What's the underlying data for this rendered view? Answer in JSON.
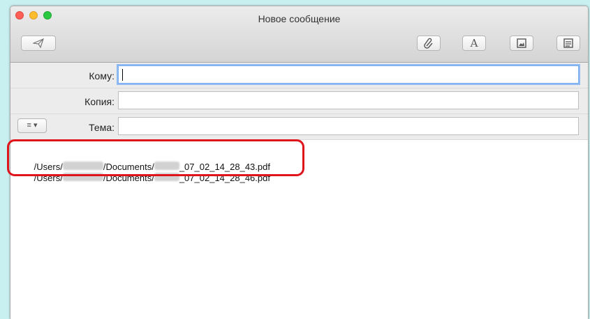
{
  "window": {
    "title": "Новое сообщение"
  },
  "toolbar": {
    "send_icon": "paper-plane-icon",
    "attach_icon": "paperclip-icon",
    "font_label": "A",
    "photo_icon": "photo-browser-icon",
    "format_icon": "format-icon"
  },
  "headers": {
    "to_label": "Кому:",
    "to_value": "",
    "cc_label": "Копия:",
    "cc_value": "",
    "subject_label": "Тема:",
    "subject_value": "",
    "menu_label": "≡ ▾"
  },
  "body": {
    "lines": [
      {
        "prefix": "/Users/",
        "middle": "/Documents/",
        "suffix": "_07_02_14_28_43.pdf"
      },
      {
        "prefix": "/Users/",
        "middle": "/Documents/",
        "suffix": "_07_02_14_28_46.pdf"
      }
    ]
  },
  "colors": {
    "highlight": "#e0141b",
    "background": "#c9f0f0",
    "focus_ring": "#8fbaf3"
  }
}
